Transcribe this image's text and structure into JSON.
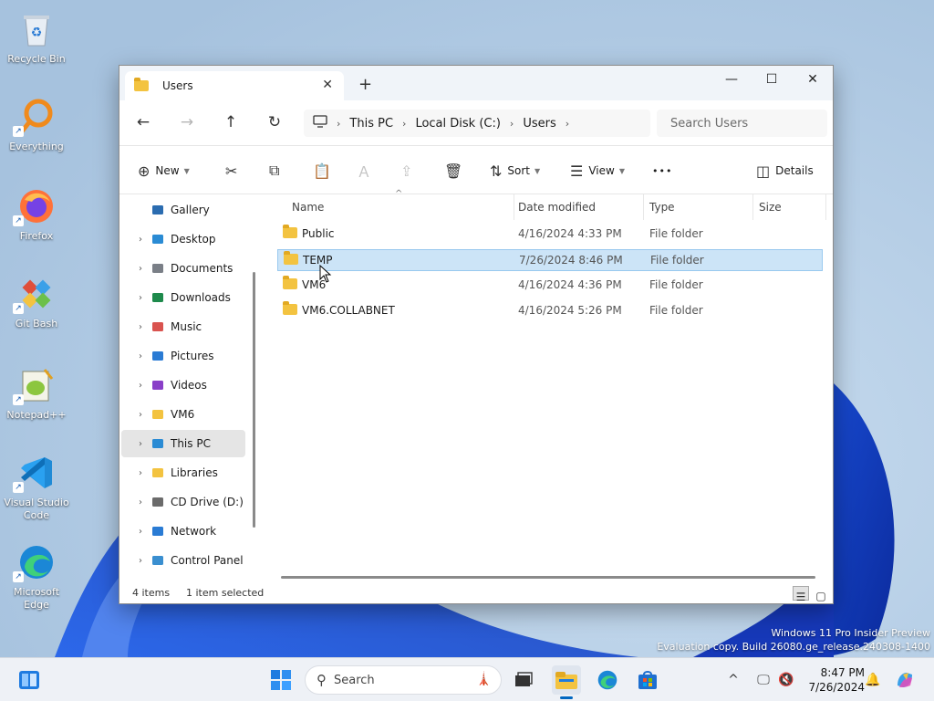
{
  "desktop": {
    "icons": [
      {
        "label": "Recycle Bin",
        "icon": "recycle-bin-icon"
      },
      {
        "label": "Everything",
        "icon": "everything-icon"
      },
      {
        "label": "Firefox",
        "icon": "firefox-icon"
      },
      {
        "label": "Git Bash",
        "icon": "git-bash-icon"
      },
      {
        "label": "Notepad++",
        "icon": "notepad-plus-plus-icon"
      },
      {
        "label": "Visual Studio Code",
        "icon": "vscode-icon"
      },
      {
        "label": "Microsoft Edge",
        "icon": "edge-icon"
      }
    ],
    "watermark": {
      "line1": "Windows 11 Pro Insider Preview",
      "line2": "Evaluation copy. Build 26080.ge_release.240308-1400"
    }
  },
  "window": {
    "tab": {
      "title": "Users",
      "close": "✕",
      "new_tab": "+"
    },
    "controls": {
      "minimize": "—",
      "maximize": "☐",
      "close": "✕"
    },
    "breadcrumb": [
      "This PC",
      "Local Disk (C:)",
      "Users"
    ],
    "search_placeholder": "Search Users",
    "toolbar": {
      "new": "New",
      "sort": "Sort",
      "view": "View",
      "more": "•••",
      "details": "Details"
    },
    "nav_items": [
      {
        "label": "Gallery",
        "icon": "gallery-icon",
        "color": "#2b6cb0",
        "has_chevron": false
      },
      {
        "label": "Desktop",
        "icon": "desktop-icon",
        "color": "#2a8bd4",
        "has_chevron": true
      },
      {
        "label": "Documents",
        "icon": "documents-icon",
        "color": "#7a7f87",
        "has_chevron": true
      },
      {
        "label": "Downloads",
        "icon": "downloads-icon",
        "color": "#1e8a4c",
        "has_chevron": true
      },
      {
        "label": "Music",
        "icon": "music-icon",
        "color": "#d9534f",
        "has_chevron": true
      },
      {
        "label": "Pictures",
        "icon": "pictures-icon",
        "color": "#2a7bd4",
        "has_chevron": true
      },
      {
        "label": "Videos",
        "icon": "videos-icon",
        "color": "#8a3fc8",
        "has_chevron": true
      },
      {
        "label": "VM6",
        "icon": "folder-icon",
        "color": "#f3c340",
        "has_chevron": true
      },
      {
        "label": "This PC",
        "icon": "this-pc-icon",
        "color": "#2a8bd4",
        "has_chevron": true,
        "selected": true
      },
      {
        "label": "Libraries",
        "icon": "libraries-icon",
        "color": "#f3c340",
        "has_chevron": true
      },
      {
        "label": "CD Drive (D:)",
        "icon": "cd-drive-icon",
        "color": "#6b6b6b",
        "has_chevron": true
      },
      {
        "label": "Network",
        "icon": "network-icon",
        "color": "#2a7bd4",
        "has_chevron": true
      },
      {
        "label": "Control Panel",
        "icon": "control-panel-icon",
        "color": "#3a8fd0",
        "has_chevron": true
      }
    ],
    "columns": [
      "Name",
      "Date modified",
      "Type",
      "Size"
    ],
    "files": [
      {
        "name": "Public",
        "date": "4/16/2024 4:33 PM",
        "type": "File folder",
        "size": ""
      },
      {
        "name": "TEMP",
        "date": "7/26/2024 8:46 PM",
        "type": "File folder",
        "size": "",
        "selected": true
      },
      {
        "name": "VM6",
        "date": "4/16/2024 4:36 PM",
        "type": "File folder",
        "size": ""
      },
      {
        "name": "VM6.COLLABNET",
        "date": "4/16/2024 5:26 PM",
        "type": "File folder",
        "size": ""
      }
    ],
    "status": {
      "count": "4 items",
      "selection": "1 item selected"
    }
  },
  "taskbar": {
    "search_placeholder": "Search",
    "clock": {
      "time": "8:47 PM",
      "date": "7/26/2024"
    },
    "accent": "#0067c0"
  }
}
